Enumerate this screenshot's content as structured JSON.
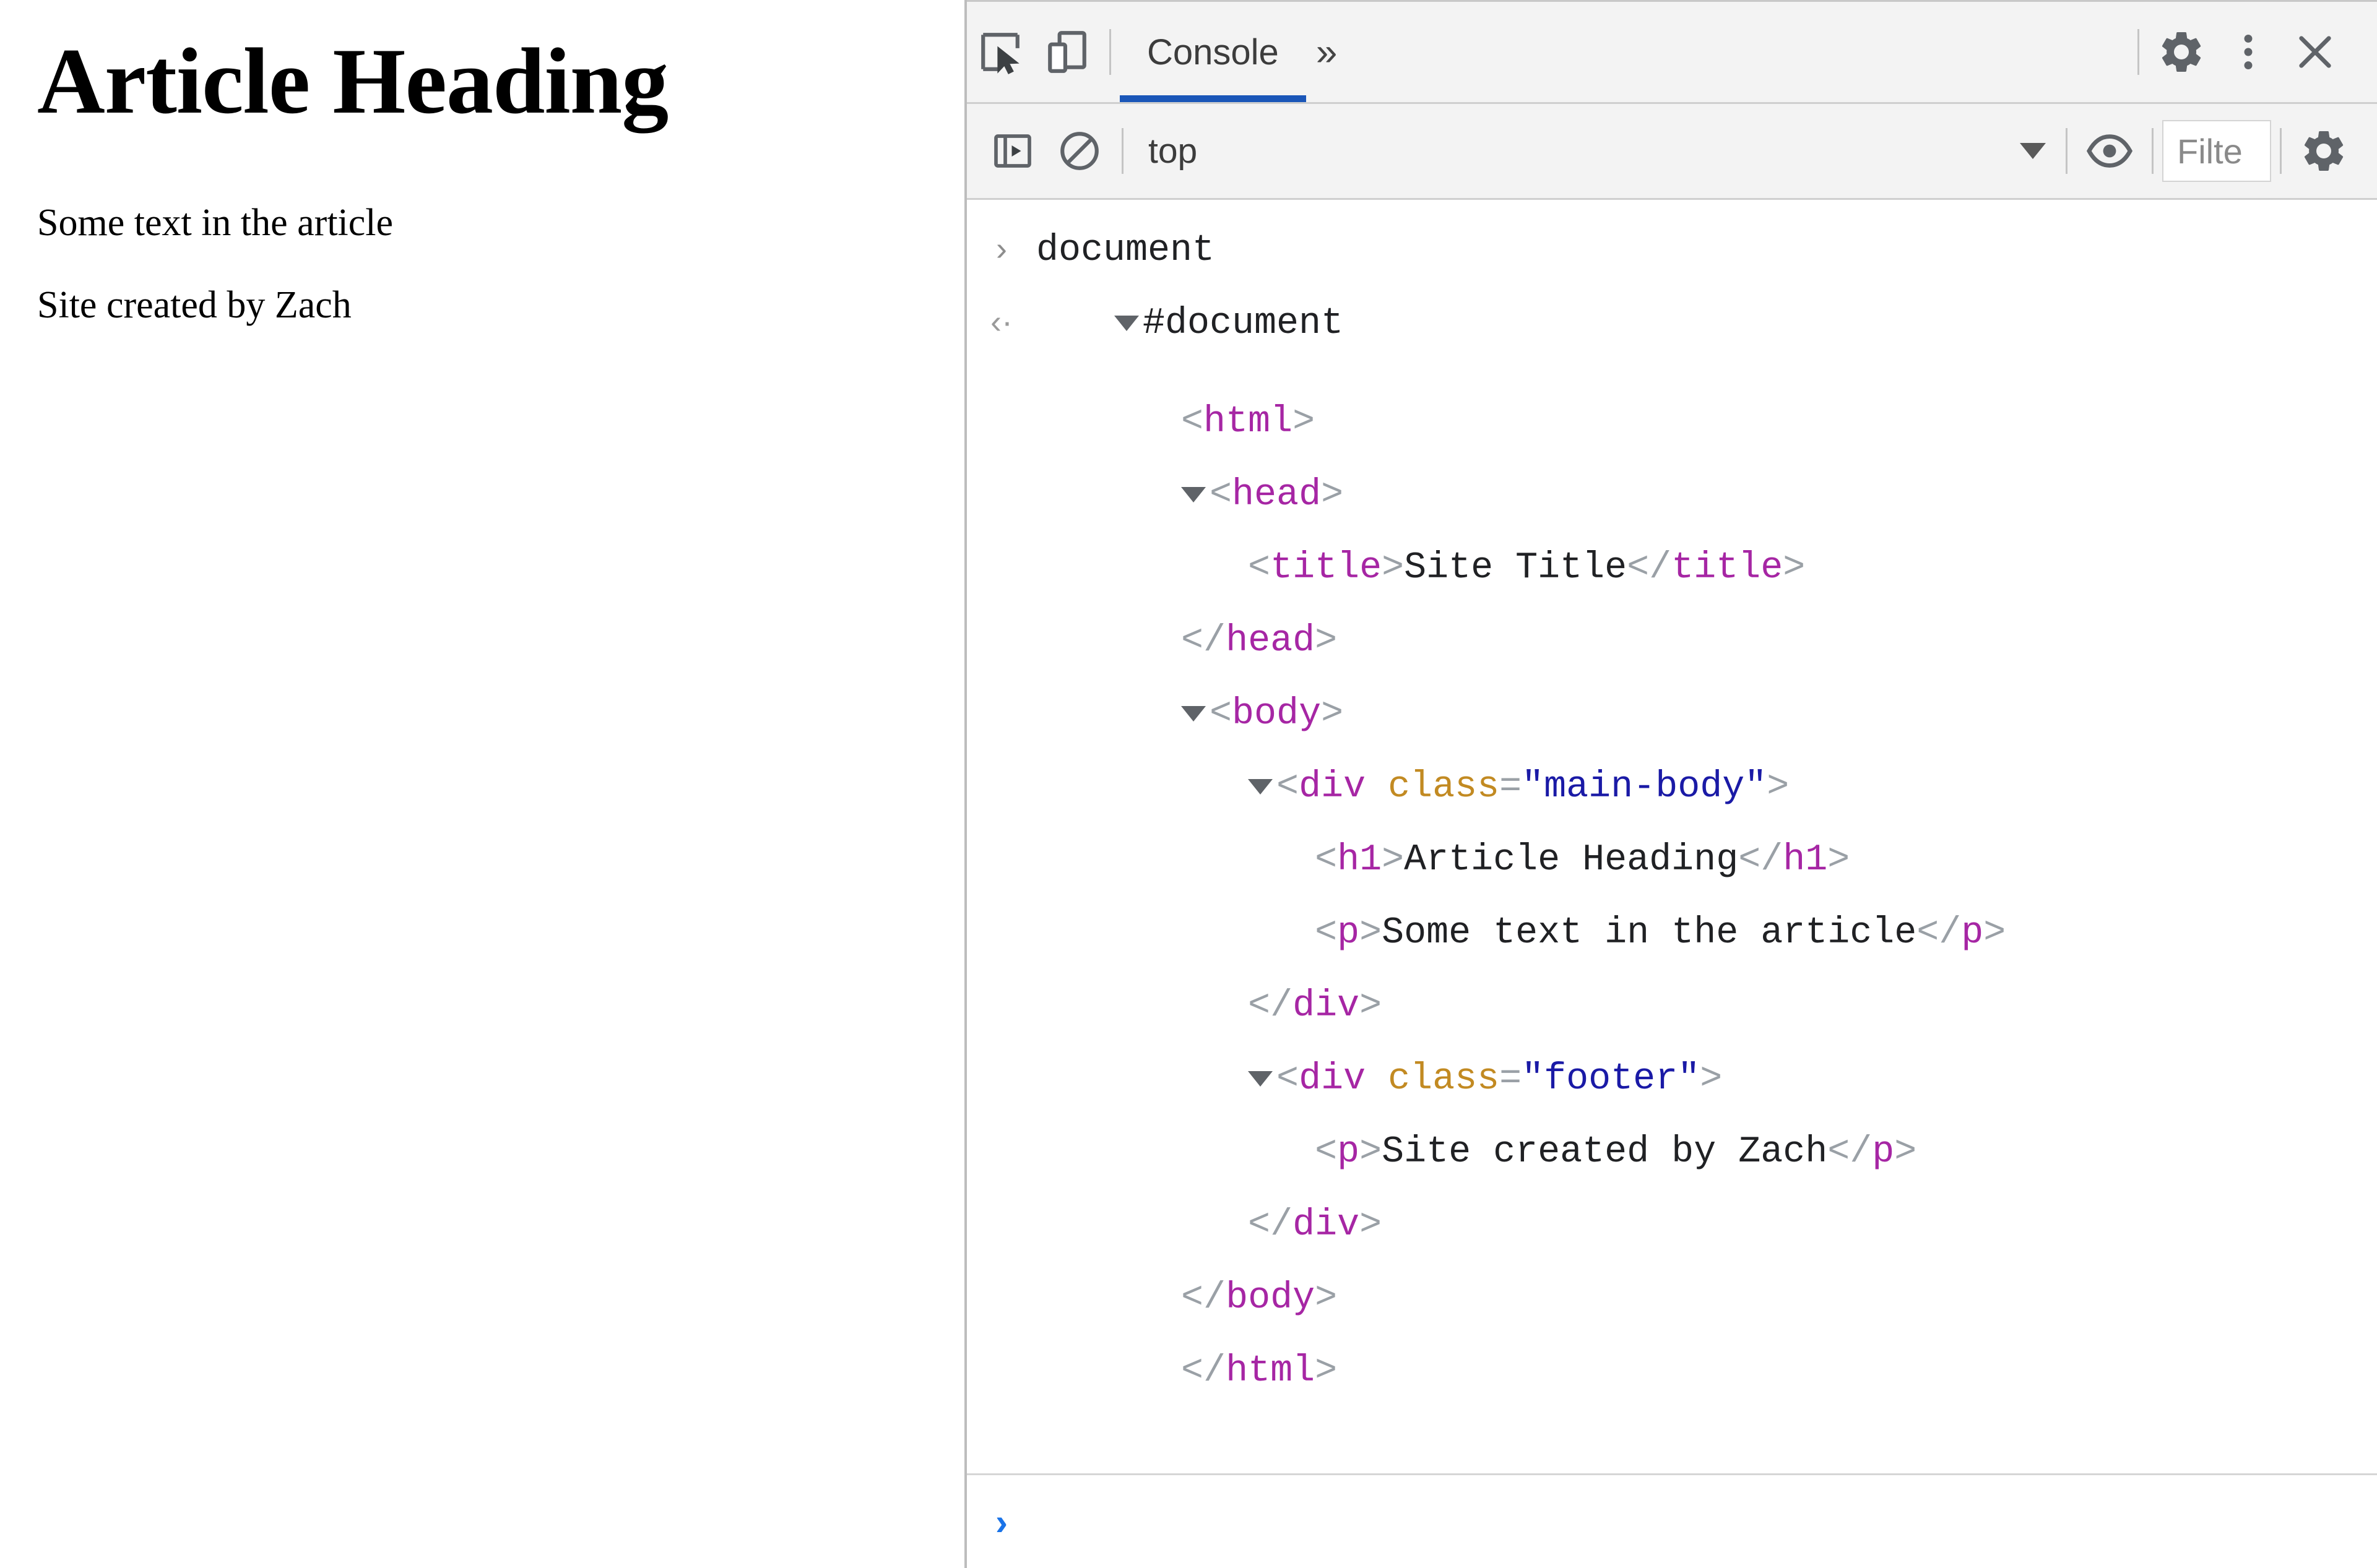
{
  "page": {
    "heading": "Article Heading",
    "paragraph": "Some text in the article",
    "footer": "Site created by Zach"
  },
  "devtools": {
    "tabbar": {
      "inspect_icon": "inspect-element-icon",
      "device_icon": "device-toolbar-icon",
      "tabs": [
        {
          "label": "Console",
          "active": true
        }
      ],
      "more_tabs_label": "»",
      "settings_icon": "gear-icon",
      "kebab_icon": "kebab-menu-icon",
      "close_icon": "close-icon"
    },
    "consolebar": {
      "sidebar_icon": "console-sidebar-icon",
      "clear_icon": "clear-console-icon",
      "context": "top",
      "eye_icon": "live-expression-eye-icon",
      "filter_placeholder": "Filte",
      "settings_icon": "gear-icon"
    },
    "console": {
      "input_prompt": "›",
      "input_expression": "document",
      "return_arrow": "‹·",
      "prompt_caret": "›",
      "lines": [
        {
          "kind": "node",
          "indent": 0,
          "triangle": true,
          "text": "#document"
        },
        {
          "kind": "tag",
          "indent": 1,
          "triangle": false,
          "tag": "html",
          "closing": false
        },
        {
          "kind": "tag",
          "indent": 1,
          "triangle": true,
          "tag": "head",
          "closing": false
        },
        {
          "kind": "element",
          "indent": 2,
          "triangle": false,
          "tag": "title",
          "text": "Site Title"
        },
        {
          "kind": "tag",
          "indent": 1,
          "triangle": false,
          "tag": "head",
          "closing": true
        },
        {
          "kind": "tag",
          "indent": 1,
          "triangle": true,
          "tag": "body",
          "closing": false
        },
        {
          "kind": "attrtag",
          "indent": 2,
          "triangle": true,
          "tag": "div",
          "attr": "class",
          "value": "main-body"
        },
        {
          "kind": "element",
          "indent": 3,
          "triangle": false,
          "tag": "h1",
          "text": "Article Heading"
        },
        {
          "kind": "element",
          "indent": 3,
          "triangle": false,
          "tag": "p",
          "text": "Some text in the article"
        },
        {
          "kind": "tag",
          "indent": 2,
          "triangle": false,
          "tag": "div",
          "closing": true
        },
        {
          "kind": "attrtag",
          "indent": 2,
          "triangle": true,
          "tag": "div",
          "attr": "class",
          "value": "footer"
        },
        {
          "kind": "element",
          "indent": 3,
          "triangle": false,
          "tag": "p",
          "text": "Site created by Zach"
        },
        {
          "kind": "tag",
          "indent": 2,
          "triangle": false,
          "tag": "div",
          "closing": true
        },
        {
          "kind": "tag",
          "indent": 1,
          "triangle": false,
          "tag": "body",
          "closing": true
        },
        {
          "kind": "tag",
          "indent": 1,
          "triangle": false,
          "tag": "html",
          "closing": true
        }
      ]
    }
  },
  "colors": {
    "tab_accent": "#1a56b8",
    "tag_name": "#a626a4",
    "attr_name": "#c28a22",
    "attr_value": "#1a1aa6",
    "bracket": "#9aa0a6",
    "prompt": "#1a73e8",
    "toolbar_bg": "#f3f3f3"
  }
}
